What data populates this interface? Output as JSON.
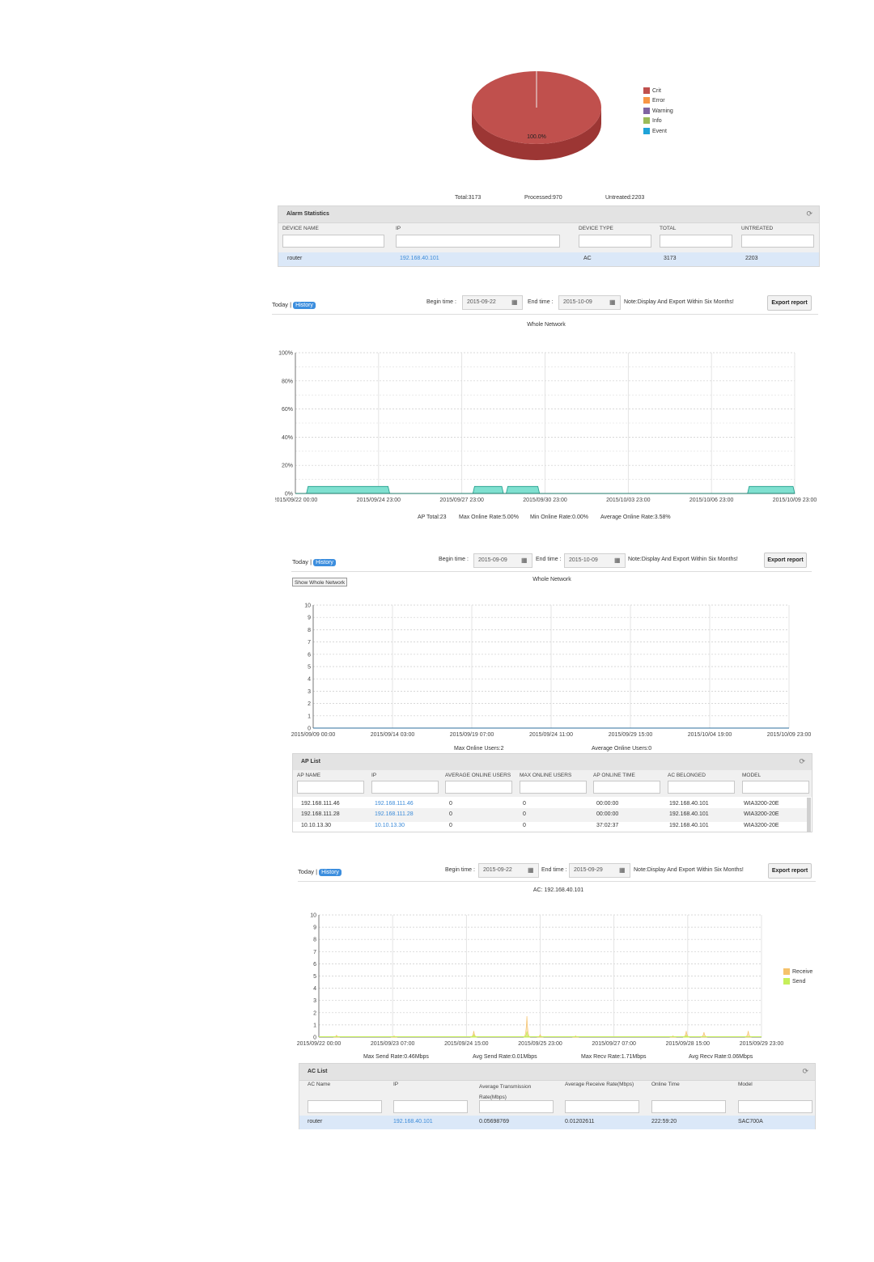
{
  "pie": {
    "slice_label": "100.0%",
    "legend": [
      {
        "label": "Crit",
        "color": "#c0504d"
      },
      {
        "label": "Error",
        "color": "#f79646"
      },
      {
        "label": "Warning",
        "color": "#8064a2"
      },
      {
        "label": "Info",
        "color": "#9bbb59"
      },
      {
        "label": "Event",
        "color": "#1fa3d8"
      }
    ]
  },
  "alarm_totals": {
    "total": "Total:3173",
    "processed": "Processed:970",
    "untreated": "Untreated:2203"
  },
  "alarm_stats": {
    "title": "Alarm Statistics",
    "columns": [
      "DEVICE NAME",
      "IP",
      "DEVICE TYPE",
      "TOTAL",
      "UNTREATED"
    ],
    "rows": [
      [
        "router",
        "192.168.40.101",
        "AC",
        "3173",
        "2203"
      ]
    ]
  },
  "section1": {
    "today": "Today |",
    "history": "History",
    "begin_label": "Begin time :",
    "begin_value": "2015-09-22",
    "end_label": "End time :",
    "end_value": "2015-10-09",
    "note": "Note:Display And Export Within Six Months!",
    "export": "Export report",
    "chart_title": "Whole Network",
    "stats": [
      "AP Total:23",
      "Max Online Rate:5.00%",
      "Min Online Rate:0.00%",
      "Average Online Rate:3.58%"
    ]
  },
  "section2": {
    "today": "Today |",
    "history": "History",
    "begin_label": "Begin time :",
    "begin_value": "2015-09-09",
    "end_label": "End time :",
    "end_value": "2015-10-09",
    "note": "Note:Display And Export Within Six Months!",
    "export": "Export report",
    "show_whole": "Show Whole Network",
    "chart_title": "Whole Network",
    "stats": [
      "Max Online Users:2",
      "Average Online Users:0"
    ]
  },
  "ap_list": {
    "title": "AP List",
    "columns": [
      "AP NAME",
      "IP",
      "AVERAGE ONLINE USERS",
      "MAX ONLINE USERS",
      "AP ONLINE TIME",
      "AC BELONGED",
      "MODEL"
    ],
    "rows": [
      [
        "192.168.111.46",
        "192.168.111.46",
        "0",
        "0",
        "00:00:00",
        "192.168.40.101",
        "WIA3200-20E"
      ],
      [
        "192.168.111.28",
        "192.168.111.28",
        "0",
        "0",
        "00:00:00",
        "192.168.40.101",
        "WIA3200-20E"
      ],
      [
        "10.10.13.30",
        "10.10.13.30",
        "0",
        "0",
        "37:02:37",
        "192.168.40.101",
        "WIA3200-20E"
      ]
    ]
  },
  "section3": {
    "today": "Today |",
    "history": "History",
    "begin_label": "Begin time :",
    "begin_value": "2015-09-22",
    "end_label": "End time :",
    "end_value": "2015-09-29",
    "note": "Note:Display And Export Within Six Months!",
    "export": "Export report",
    "chart_title": "AC: 192.168.40.101",
    "legend": [
      {
        "label": "Receive",
        "color": "#f5c26b"
      },
      {
        "label": "Send",
        "color": "#c6ef5a"
      }
    ],
    "stats": [
      "Max Send Rate:0.46Mbps",
      "Avg Send Rate:0.01Mbps",
      "Max Recv Rate:1.71Mbps",
      "Avg Recv Rate:0.06Mbps"
    ]
  },
  "ac_list": {
    "title": "AC List",
    "columns": [
      "AC Name",
      "IP",
      "Average Transmission Rate(Mbps)",
      "Average Receive Rate(Mbps)",
      "Online Time",
      "Model"
    ],
    "rows": [
      [
        "router",
        "192.168.40.101",
        "0.05698769",
        "0.01202611",
        "222:59:20",
        "SAC700A"
      ]
    ]
  },
  "chart_data": [
    {
      "type": "pie",
      "categories": [
        "Crit",
        "Error",
        "Warning",
        "Info",
        "Event"
      ],
      "values": [
        100,
        0,
        0,
        0,
        0
      ],
      "title": ""
    },
    {
      "type": "area",
      "title": "Whole Network",
      "xlabel": "",
      "ylabel": "",
      "x_ticks": [
        "2015/09/22 00:00",
        "2015/09/24 23:00",
        "2015/09/27 23:00",
        "2015/09/30 23:00",
        "2015/10/03 23:00",
        "2015/10/06 23:00",
        "2015/10/09 23:00"
      ],
      "y_ticks": [
        "0%",
        "20%",
        "40%",
        "60%",
        "80%",
        "100%"
      ],
      "ylim": [
        0,
        100
      ],
      "xlim_days": [
        0,
        18
      ],
      "segments": [
        {
          "start_day": 0.4,
          "end_day": 3.4,
          "value": 5
        },
        {
          "start_day": 6.4,
          "end_day": 7.5,
          "value": 5
        },
        {
          "start_day": 7.6,
          "end_day": 8.8,
          "value": 5
        },
        {
          "start_day": 16.3,
          "end_day": 18.0,
          "value": 5
        }
      ],
      "grid": true
    },
    {
      "type": "line",
      "title": "Whole Network",
      "x_ticks": [
        "2015/09/09 00:00",
        "2015/09/14 03:00",
        "2015/09/19 07:00",
        "2015/09/24 11:00",
        "2015/09/29 15:00",
        "2015/10/04 19:00",
        "2015/10/09 23:00"
      ],
      "y_ticks": [
        "0",
        "1",
        "2",
        "3",
        "4",
        "5",
        "6",
        "7",
        "8",
        "9",
        "10"
      ],
      "ylim": [
        0,
        10
      ],
      "series": [
        {
          "values": [
            0,
            0,
            0,
            0,
            0,
            0,
            0
          ]
        }
      ],
      "grid": true
    },
    {
      "type": "area",
      "title": "AC: 192.168.40.101",
      "x_ticks": [
        "2015/09/22 00:00",
        "2015/09/23 07:00",
        "2015/09/24 15:00",
        "2015/09/25 23:00",
        "2015/09/27 07:00",
        "2015/09/28 15:00",
        "2015/09/29 23:00"
      ],
      "y_ticks": [
        "0",
        "1",
        "2",
        "3",
        "4",
        "5",
        "6",
        "7",
        "8",
        "9",
        "10"
      ],
      "ylim": [
        0,
        10
      ],
      "legend_position": "right",
      "series": [
        {
          "name": "Receive",
          "peaks_x_frac": [
            0.04,
            0.17,
            0.35,
            0.47,
            0.5,
            0.58,
            0.8,
            0.83,
            0.87,
            0.97
          ],
          "peaks_y": [
            0.15,
            0.1,
            0.5,
            1.71,
            0.2,
            0.1,
            0.1,
            0.5,
            0.4,
            0.5
          ]
        },
        {
          "name": "Send",
          "peaks_x_frac": [
            0.35,
            0.47,
            0.83
          ],
          "peaks_y": [
            0.2,
            0.46,
            0.15
          ]
        }
      ],
      "legend": [
        "Receive",
        "Send"
      ],
      "grid": true
    }
  ]
}
